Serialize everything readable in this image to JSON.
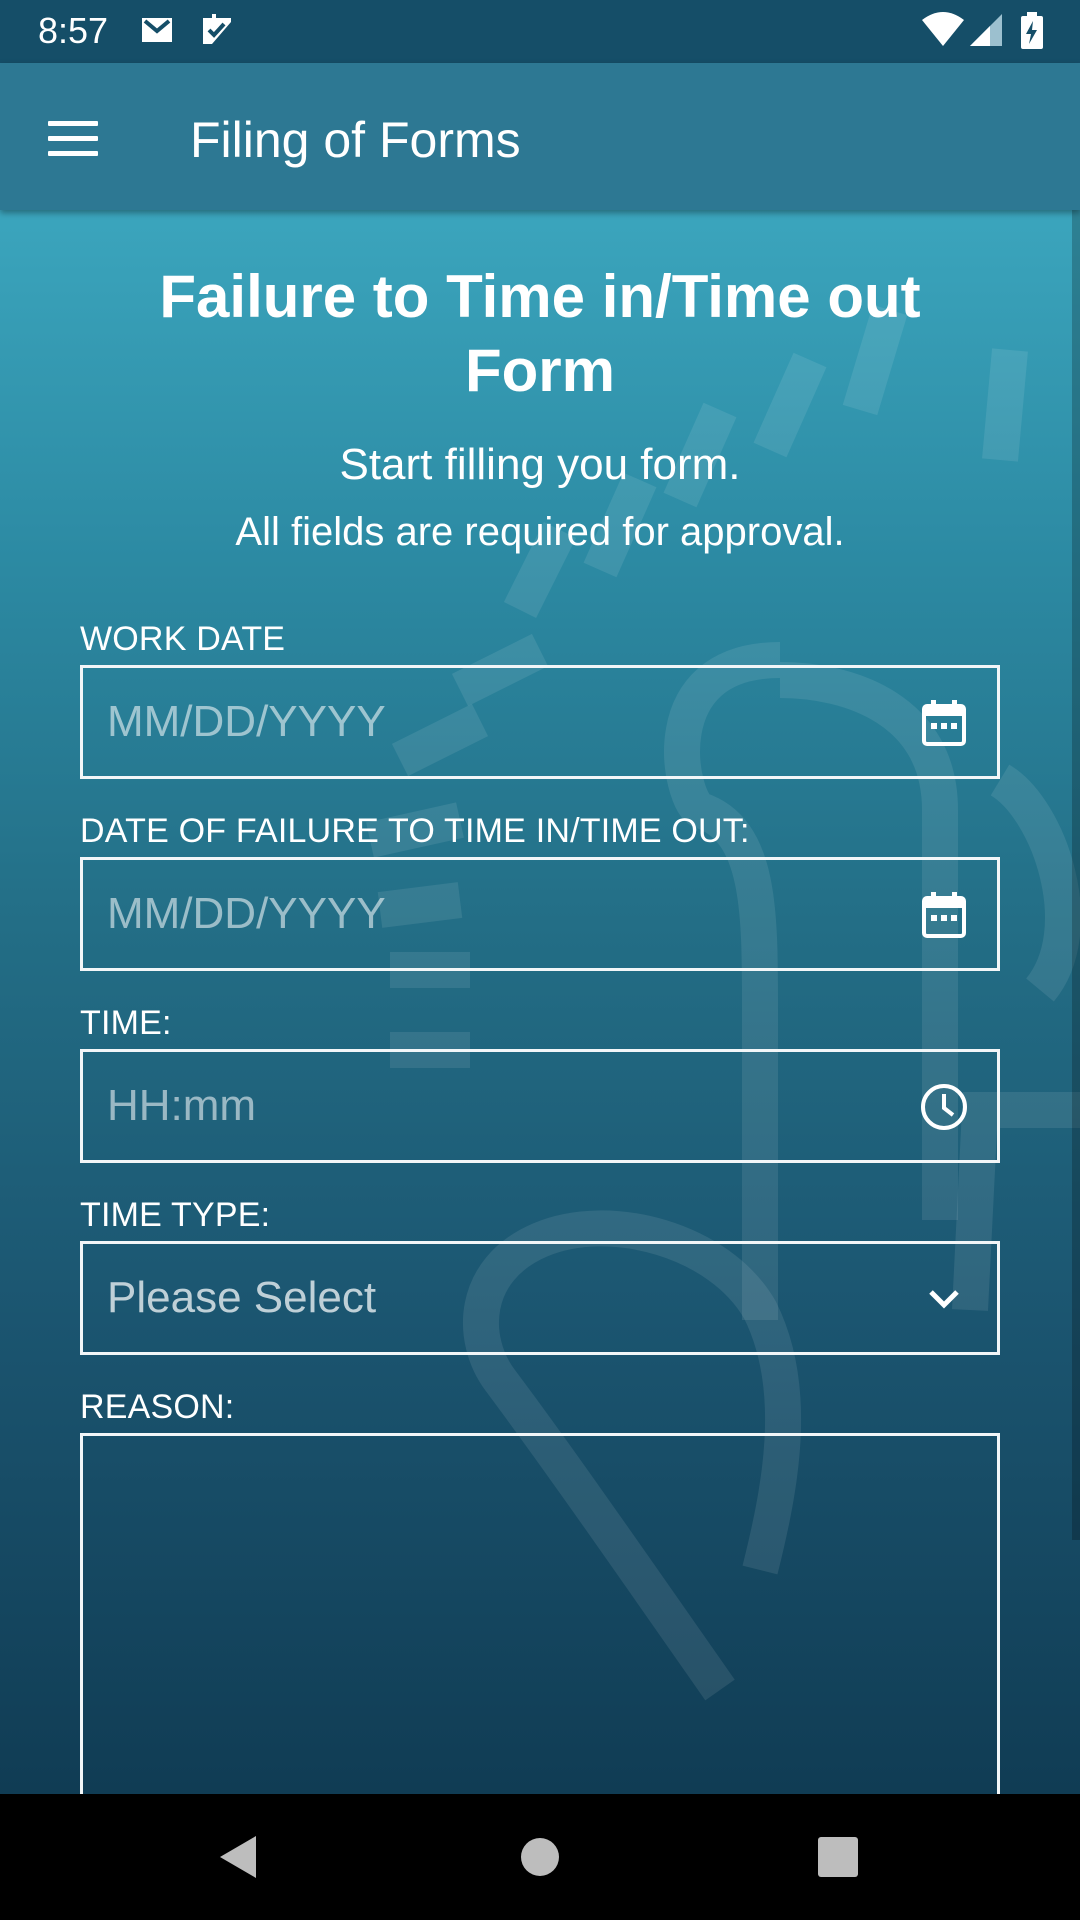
{
  "status_bar": {
    "time": "8:57",
    "left_icons": [
      "gmail-icon",
      "checkmark-notification-icon"
    ],
    "right_icons": [
      "wifi-icon",
      "cell-signal-icon",
      "battery-charging-icon"
    ]
  },
  "app_bar": {
    "menu_icon": "hamburger-menu-icon",
    "title": "Filing of Forms"
  },
  "form": {
    "title_line1": "Failure to Time in/Time out",
    "title_line2": "Form",
    "subtitle1": "Start filling you form.",
    "subtitle2": "All fields are required for approval.",
    "fields": [
      {
        "label": "WORK DATE",
        "placeholder": "MM/DD/YYYY",
        "icon": "calendar-icon"
      },
      {
        "label": "DATE OF FAILURE TO TIME IN/TIME OUT:",
        "placeholder": "MM/DD/YYYY",
        "icon": "calendar-icon"
      },
      {
        "label": "TIME:",
        "placeholder": "HH:mm",
        "icon": "clock-icon"
      },
      {
        "label": "TIME TYPE:",
        "selected": "Please Select",
        "icon": "chevron-down-icon"
      },
      {
        "label": "REASON:",
        "value": ""
      }
    ]
  },
  "nav_bar": {
    "buttons": [
      "back-triangle-icon",
      "home-circle-icon",
      "recents-square-icon"
    ]
  },
  "colors": {
    "status_bar": "#154e68",
    "app_bar": "#2d7893",
    "gradient_top": "#3ba5bd",
    "gradient_bottom": "#103c54",
    "field_border": "#f2f6f8"
  }
}
